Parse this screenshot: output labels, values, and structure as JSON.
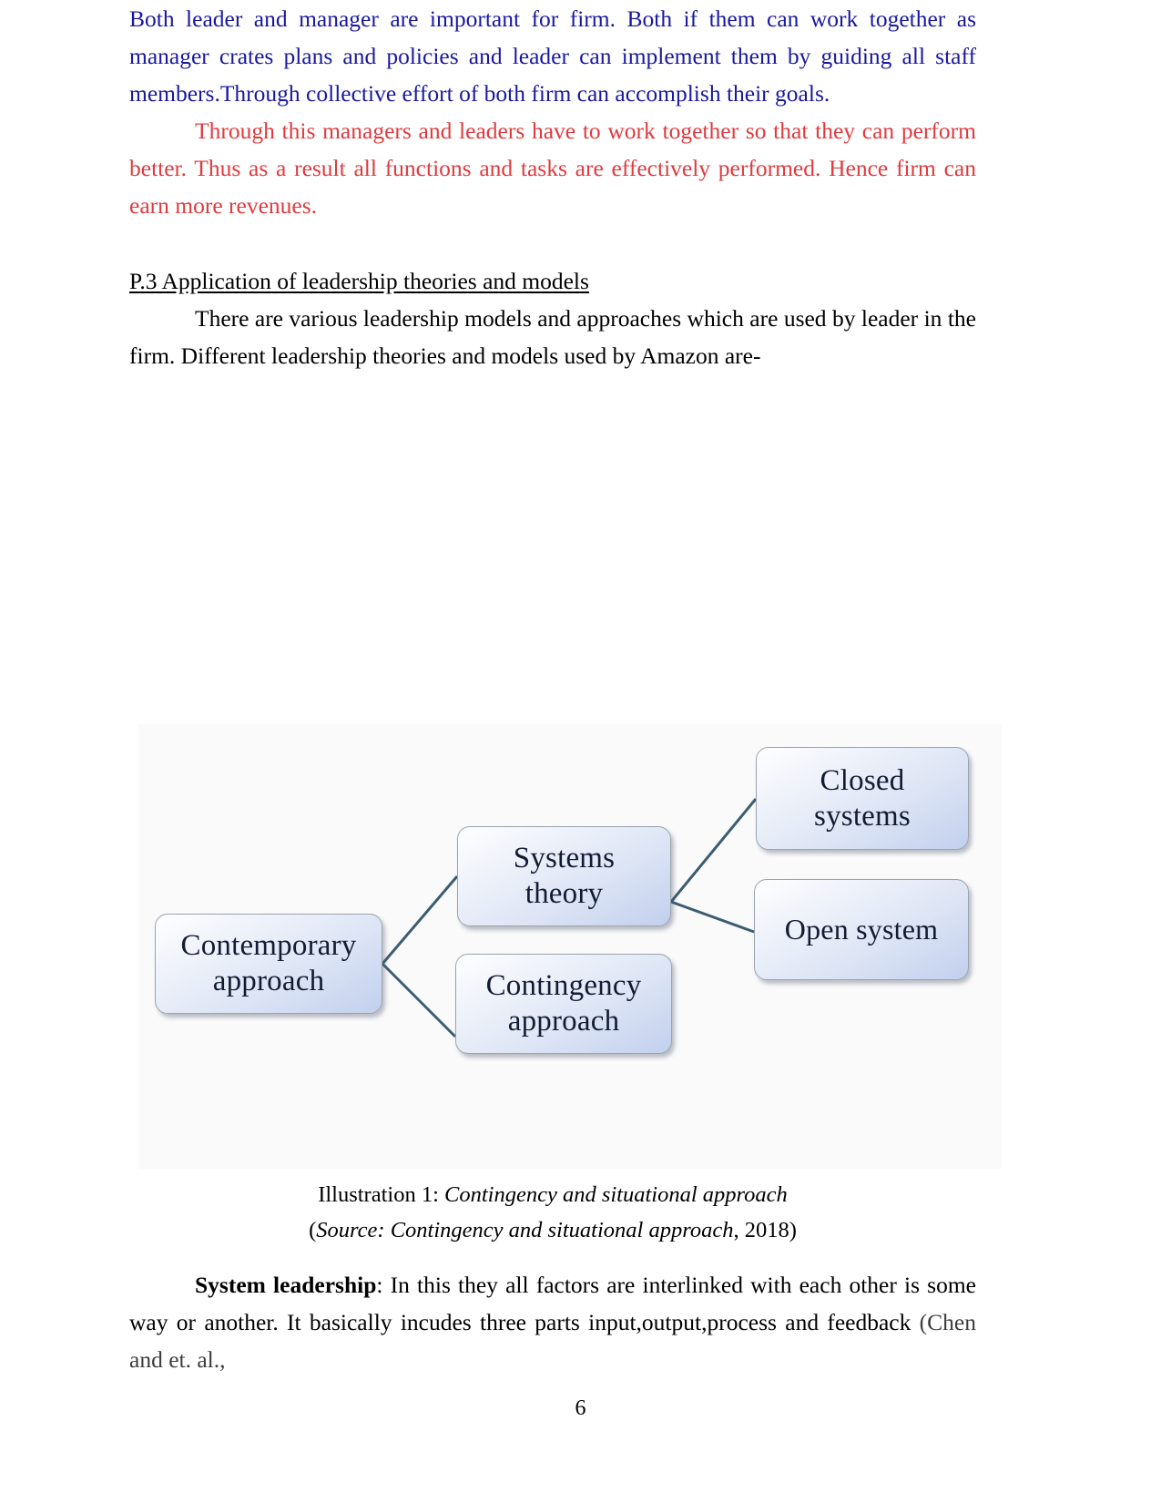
{
  "document": {
    "page_number": "6"
  },
  "paragraphs": {
    "blue_text": "Both leader and manager are important for firm. Both if them can work together as manager crates plans and policies and leader can implement them by guiding all staff members.Through collective effort of both firm can accomplish their goals.",
    "blue_color": "#1a18a0",
    "red_text": "Through this managers and leaders have to work together so that they can perform better. Thus as a result all functions and tasks are effectively performed. Hence firm can earn more revenues.",
    "red_color": "#e03a3e",
    "heading": "P.3 Application of leadership theories and models",
    "intro_text": "There are various leadership models and approaches which are used by leader in the firm. Different leadership theories and models used by Amazon are-",
    "closing_label": "System leadership",
    "closing_text": ": In this they all  factors are interlinked with each other is some way or another. It basically incudes three parts input,output,process and feedback ",
    "closing_citation": "(Chen and et. al.,"
  },
  "figure": {
    "caption_prefix": "Illustration 1: ",
    "caption_title": "Contingency and situational approach",
    "source_prefix": "(",
    "source_italic": "Source: Contingency and situational approach",
    "source_suffix": ", 2018)",
    "background_color": "#fafafb",
    "box_border_color": "#9aa3ae",
    "box_text_color": "#141c33",
    "connector_color": "#3c5c70",
    "boxes": {
      "contemporary": "Contemporary approach",
      "systems": "Systems theory",
      "contingency": "Contingency approach",
      "closed": "Closed systems",
      "open": "Open system"
    },
    "box_lines": {
      "contemporary": [
        "Contemporary",
        "approach"
      ],
      "systems": [
        "Systems",
        "theory"
      ],
      "contingency": [
        "Contingency",
        "approach"
      ],
      "closed": [
        "Closed",
        "systems"
      ],
      "open": [
        "Open system"
      ]
    }
  }
}
